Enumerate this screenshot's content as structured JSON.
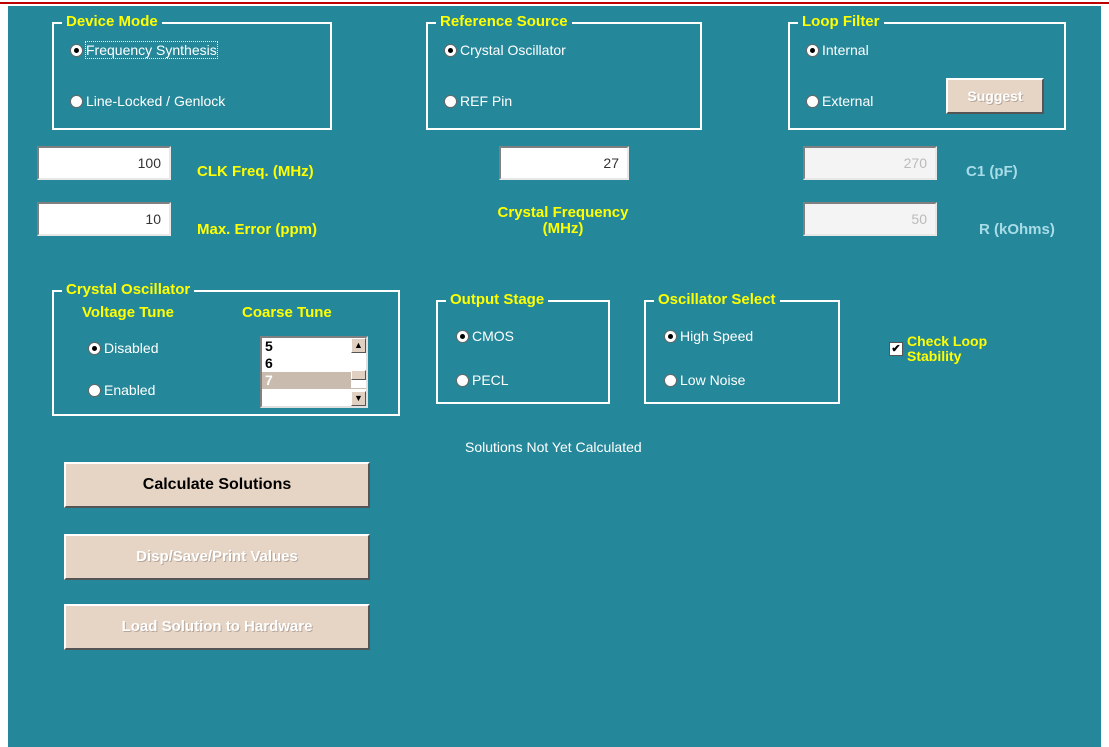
{
  "device_mode": {
    "title": "Device Mode",
    "options": [
      "Frequency Synthesis",
      "Line-Locked / Genlock"
    ],
    "selected": "Frequency Synthesis"
  },
  "reference_source": {
    "title": "Reference Source",
    "options": [
      "Crystal Oscillator",
      "REF Pin"
    ],
    "selected": "Crystal Oscillator"
  },
  "loop_filter": {
    "title": "Loop Filter",
    "options": [
      "Internal",
      "External"
    ],
    "selected": "Internal",
    "suggest_label": "Suggest"
  },
  "fields": {
    "clk_freq": {
      "value": "100",
      "label": "CLK Freq. (MHz)"
    },
    "max_error": {
      "value": "10",
      "label": "Max. Error (ppm)"
    },
    "crystal_freq": {
      "value": "27",
      "label_line1": "Crystal Frequency",
      "label_line2": "(MHz)"
    },
    "c1": {
      "value": "270",
      "label": "C1 (pF)"
    },
    "r": {
      "value": "50",
      "label": "R (kOhms)"
    }
  },
  "crystal_oscillator": {
    "title": "Crystal Oscillator",
    "voltage_tune_title": "Voltage Tune",
    "coarse_tune_title": "Coarse Tune",
    "options": [
      "Disabled",
      "Enabled"
    ],
    "selected": "Disabled",
    "coarse_items": [
      "5",
      "6",
      "7"
    ],
    "scroll_up": "▲",
    "scroll_down": "▼"
  },
  "output_stage": {
    "title": "Output Stage",
    "options": [
      "CMOS",
      "PECL"
    ],
    "selected": "CMOS"
  },
  "oscillator_select": {
    "title": "Oscillator Select",
    "options": [
      "High Speed",
      "Low Noise"
    ],
    "selected": "High Speed"
  },
  "check_loop": {
    "line1": "Check Loop",
    "line2": "Stability",
    "checked": true,
    "mark": "✔"
  },
  "status_text": "Solutions Not Yet Calculated",
  "buttons": {
    "calculate": "Calculate Solutions",
    "disp_save_print": "Disp/Save/Print Values",
    "load_solution": "Load Solution to Hardware"
  },
  "colors": {
    "panel": "#25889a",
    "label": "#ffff00",
    "accent_border": "#c00000"
  }
}
